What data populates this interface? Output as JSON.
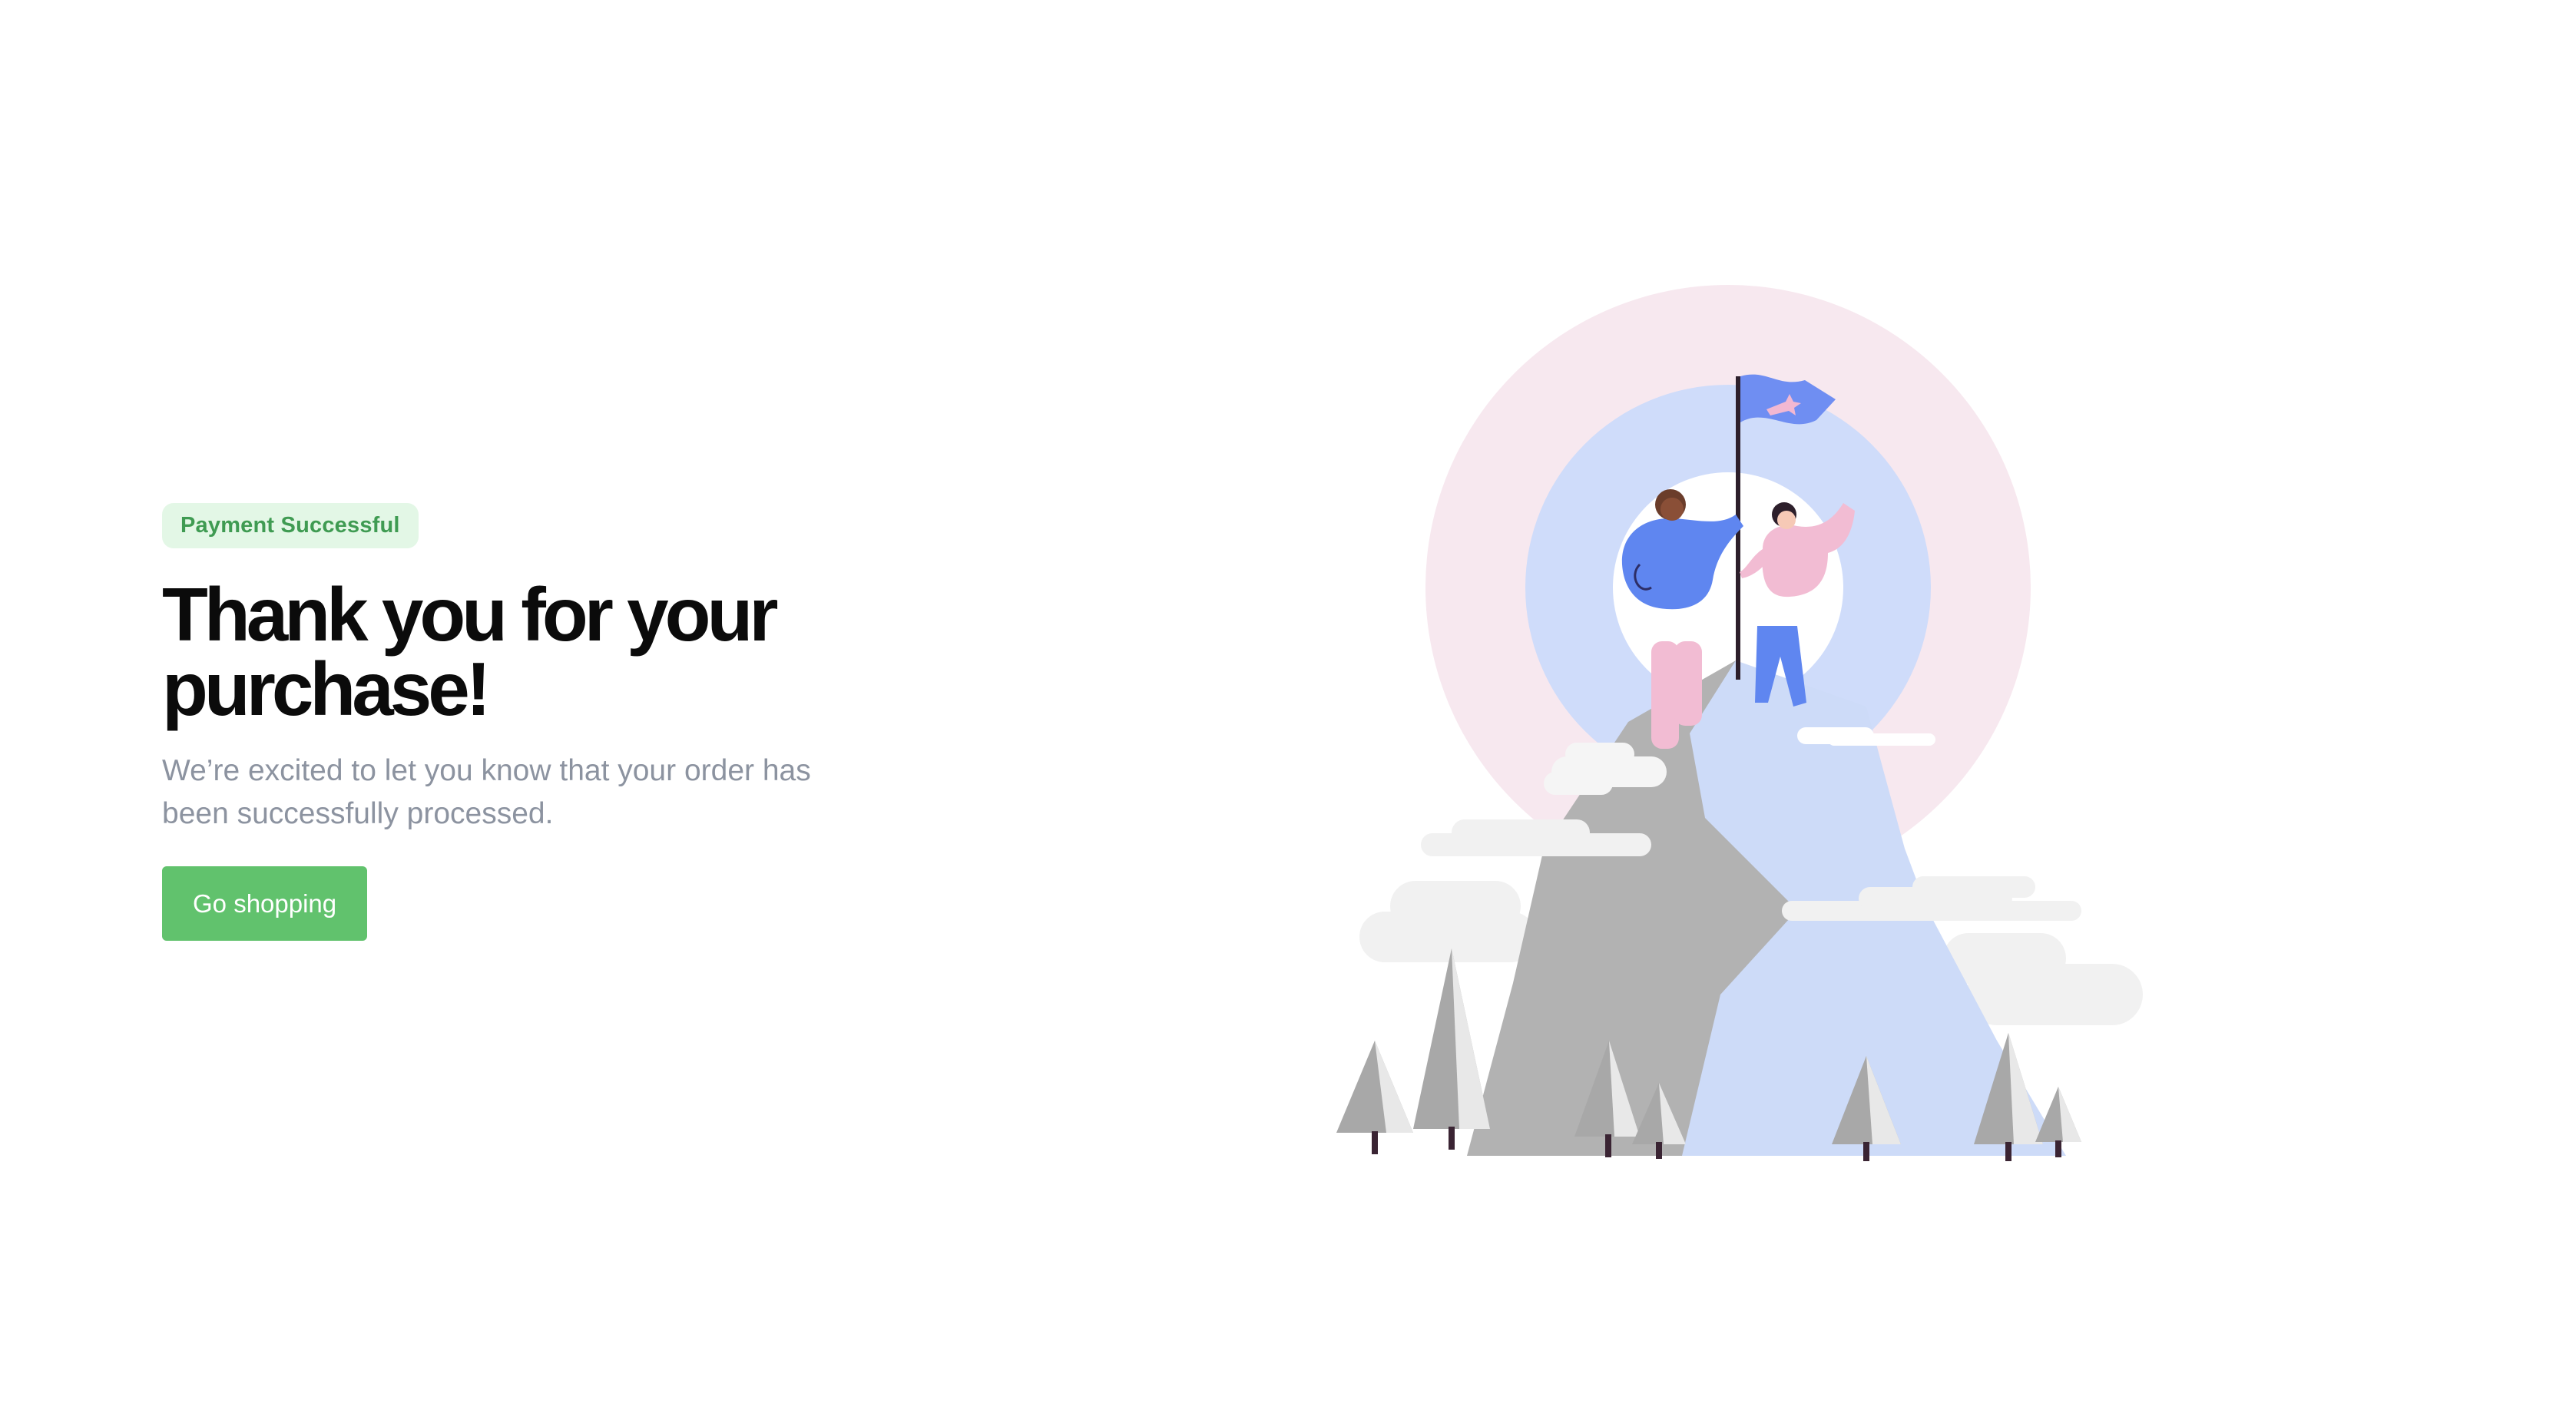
{
  "badge": {
    "label": "Payment Successful"
  },
  "heading": {
    "text": "Thank you for your purchase!"
  },
  "message": {
    "text": "We’re excited to let you know that your order has been successfully processed."
  },
  "cta": {
    "label": "Go shopping"
  },
  "illustration": {
    "subject": "mountain-summit-with-flag"
  },
  "colors": {
    "badge_bg": "#e3f7e6",
    "badge_text": "#3f9b52",
    "button_bg": "#61c26d",
    "heading": "#0b0b0b",
    "subtitle": "#8c93a0",
    "outer_ring": "#f7e8ef",
    "inner_ring": "#cfdcfa",
    "flag": "#6f8ef2",
    "mountain_grey": "#b2b2b2",
    "mountain_blue": "#cddbf8"
  }
}
